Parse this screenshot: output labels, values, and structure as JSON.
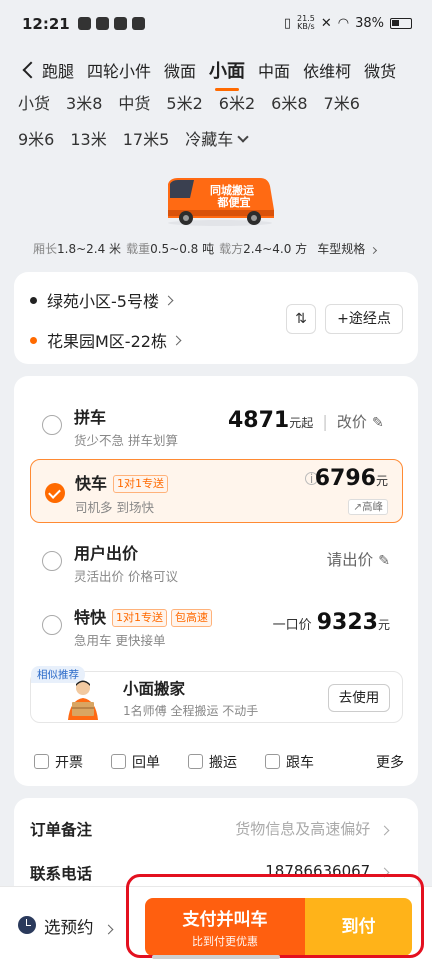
{
  "status_bar": {
    "time": "12:21",
    "net_speed_value": "21.5",
    "net_speed_unit": "KB/s",
    "battery": "38%"
  },
  "tabs": [
    {
      "label": "跑腿",
      "active": false
    },
    {
      "label": "四轮小件",
      "active": false
    },
    {
      "label": "微面",
      "active": false
    },
    {
      "label": "小面",
      "active": true
    },
    {
      "label": "中面",
      "active": false
    },
    {
      "label": "依维柯",
      "active": false
    },
    {
      "label": "微货",
      "active": false
    }
  ],
  "sizes": [
    "小货",
    "3米8",
    "中货",
    "5米2",
    "6米2",
    "6米8",
    "7米6",
    "9米6",
    "13米",
    "17米5",
    "冷藏车"
  ],
  "vehicle_image_text": {
    "line1": "同城搬运",
    "line2": "都便宜"
  },
  "specs": {
    "length_label": "厢长",
    "length_value": "1.8~2.4 米",
    "load_label": "载重",
    "load_value": "0.5~0.8 吨",
    "volume_label": "载方",
    "volume_value": "2.4~4.0 方",
    "link": "车型规格"
  },
  "route": {
    "start": "绿苑小区-5号楼",
    "end": "花果园M区-22栋",
    "swap_icon": "⇅",
    "via_button": "+途经点"
  },
  "options": [
    {
      "title": "拼车",
      "subtitle": "货少不急 拼车划算",
      "price": "4871",
      "unit": "元起",
      "action": "改价",
      "selected": false
    },
    {
      "title": "快车",
      "badge": "1对1专送",
      "subtitle": "司机多 到场快",
      "price": "6796",
      "unit": "元",
      "tag": "高峰",
      "selected": true
    },
    {
      "title": "用户出价",
      "subtitle": "灵活出价 价格可议",
      "action": "请出价",
      "selected": false
    },
    {
      "title": "特快",
      "badge": "1对1专送",
      "badge2": "包高速",
      "subtitle": "急用车 更快接单",
      "price_prefix": "一口价",
      "price": "9323",
      "unit": "元",
      "selected": false
    }
  ],
  "recommend": {
    "tag": "相似推荐",
    "title": "小面搬家",
    "subtitle": "1名师傅 全程搬运 不动手",
    "button": "去使用"
  },
  "extras": [
    "开票",
    "回单",
    "搬运",
    "跟车"
  ],
  "extras_more": "更多",
  "remarks": {
    "label": "订单备注",
    "placeholder": "货物信息及高速偏好"
  },
  "phone": {
    "label": "联系电话",
    "value": "18786636067"
  },
  "bottom": {
    "reserve": "选预约",
    "pay_main": "支付并叫车",
    "pay_sub": "比到付更优惠",
    "cod": "到付"
  },
  "colors": {
    "accent": "#ff6a00",
    "pay": "#ff5f0f",
    "cod": "#ffb319",
    "highlight": "#e3101f"
  }
}
